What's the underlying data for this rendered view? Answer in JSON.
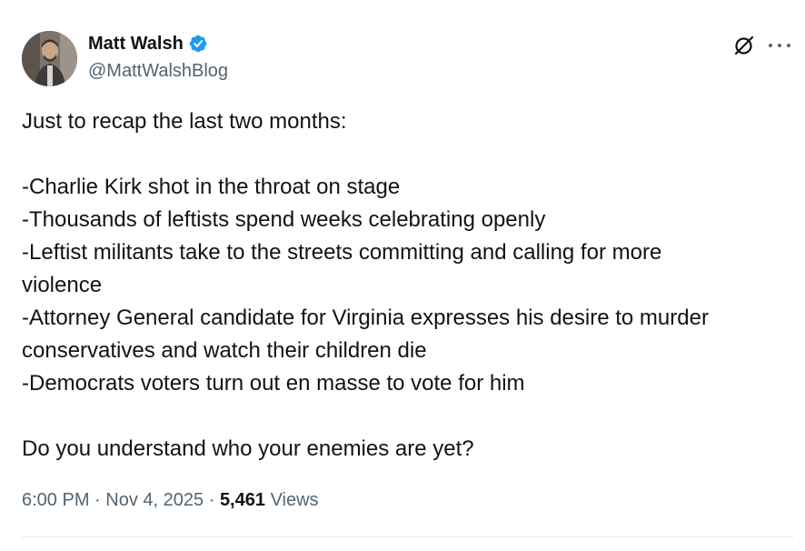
{
  "author": {
    "display_name": "Matt Walsh",
    "handle": "@MattWalshBlog",
    "verified": true
  },
  "tweet": {
    "lines": [
      "Just to recap the last two months:",
      "",
      "-Charlie Kirk shot in the throat on stage",
      "-Thousands of leftists spend weeks celebrating openly",
      "-Leftist militants take to the streets committing and calling for more",
      "violence",
      "-Attorney General candidate for Virginia expresses his desire to murder",
      "conservatives and watch their children die",
      "-Democrats voters turn out en masse to vote for him",
      "",
      "Do you understand who your enemies are yet?"
    ],
    "time": "6:00 PM",
    "separator": "·",
    "date": "Nov 4, 2025",
    "views_count": "5,461",
    "views_label": "Views"
  },
  "icons": {
    "verified": "verified-badge-icon",
    "grok": "grok-icon",
    "more": "more-options-icon"
  },
  "colors": {
    "verified_blue": "#1d9bf0",
    "text_primary": "#0f1419",
    "text_secondary": "#536471",
    "divider": "#e6ecf0"
  }
}
